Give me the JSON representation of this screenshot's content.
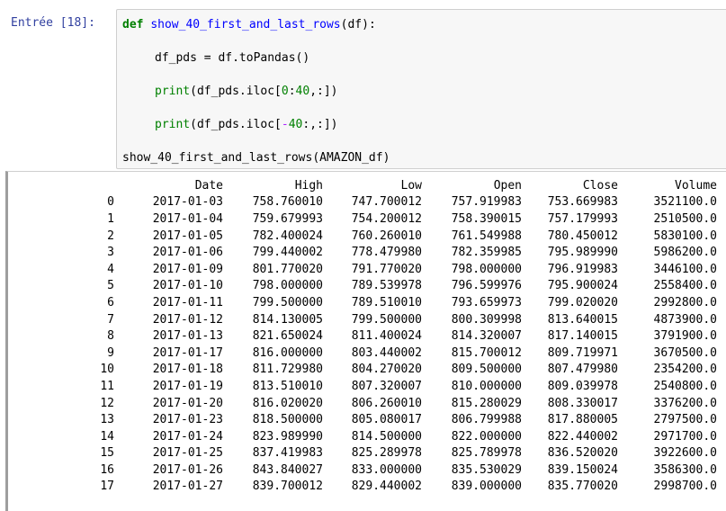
{
  "cell": {
    "prompt": "Entrée [18]:",
    "code": {
      "line1_kw": "def",
      "line1_fn": "show_40_first_and_last_rows",
      "line1_rest": "(df):",
      "line2": "df_pds = df.toPandas()",
      "line3_print": "print",
      "line3_rest_a": "(df_pds.iloc[",
      "line3_num": "0",
      "line3_colon": ":",
      "line3_num2": "40",
      "line3_rest_b": ",:])",
      "line4_print": "print",
      "line4_rest_a": "(df_pds.iloc[",
      "line4_op": "-",
      "line4_num": "40",
      "line4_rest_b": ":,:])",
      "line5": "show_40_first_and_last_rows(AMAZON_df)"
    }
  },
  "output": {
    "columns": [
      "",
      "Date",
      "High",
      "Low",
      "Open",
      "Close",
      "Volume"
    ],
    "rows": [
      [
        "0",
        "2017-01-03",
        "758.760010",
        "747.700012",
        "757.919983",
        "753.669983",
        "3521100.0"
      ],
      [
        "1",
        "2017-01-04",
        "759.679993",
        "754.200012",
        "758.390015",
        "757.179993",
        "2510500.0"
      ],
      [
        "2",
        "2017-01-05",
        "782.400024",
        "760.260010",
        "761.549988",
        "780.450012",
        "5830100.0"
      ],
      [
        "3",
        "2017-01-06",
        "799.440002",
        "778.479980",
        "782.359985",
        "795.989990",
        "5986200.0"
      ],
      [
        "4",
        "2017-01-09",
        "801.770020",
        "791.770020",
        "798.000000",
        "796.919983",
        "3446100.0"
      ],
      [
        "5",
        "2017-01-10",
        "798.000000",
        "789.539978",
        "796.599976",
        "795.900024",
        "2558400.0"
      ],
      [
        "6",
        "2017-01-11",
        "799.500000",
        "789.510010",
        "793.659973",
        "799.020020",
        "2992800.0"
      ],
      [
        "7",
        "2017-01-12",
        "814.130005",
        "799.500000",
        "800.309998",
        "813.640015",
        "4873900.0"
      ],
      [
        "8",
        "2017-01-13",
        "821.650024",
        "811.400024",
        "814.320007",
        "817.140015",
        "3791900.0"
      ],
      [
        "9",
        "2017-01-17",
        "816.000000",
        "803.440002",
        "815.700012",
        "809.719971",
        "3670500.0"
      ],
      [
        "10",
        "2017-01-18",
        "811.729980",
        "804.270020",
        "809.500000",
        "807.479980",
        "2354200.0"
      ],
      [
        "11",
        "2017-01-19",
        "813.510010",
        "807.320007",
        "810.000000",
        "809.039978",
        "2540800.0"
      ],
      [
        "12",
        "2017-01-20",
        "816.020020",
        "806.260010",
        "815.280029",
        "808.330017",
        "3376200.0"
      ],
      [
        "13",
        "2017-01-23",
        "818.500000",
        "805.080017",
        "806.799988",
        "817.880005",
        "2797500.0"
      ],
      [
        "14",
        "2017-01-24",
        "823.989990",
        "814.500000",
        "822.000000",
        "822.440002",
        "2971700.0"
      ],
      [
        "15",
        "2017-01-25",
        "837.419983",
        "825.289978",
        "825.789978",
        "836.520020",
        "3922600.0"
      ],
      [
        "16",
        "2017-01-26",
        "843.840027",
        "833.000000",
        "835.530029",
        "839.150024",
        "3586300.0"
      ],
      [
        "17",
        "2017-01-27",
        "839.700012",
        "829.440002",
        "839.000000",
        "835.770020",
        "2998700.0"
      ]
    ]
  }
}
